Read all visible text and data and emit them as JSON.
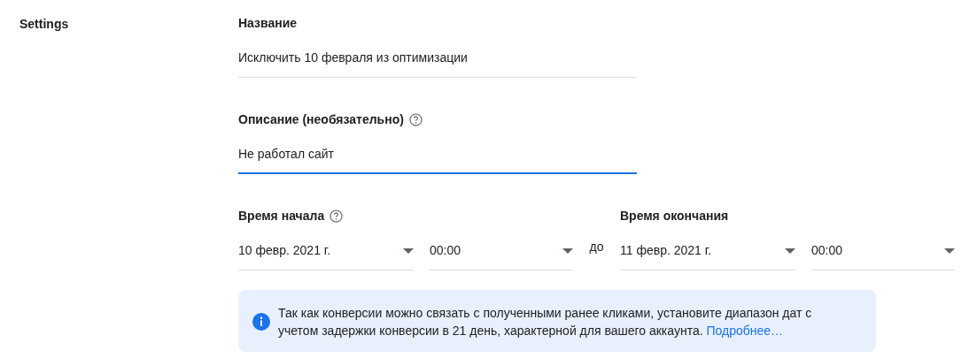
{
  "section_title": "Settings",
  "fields": [
    {
      "label": "Название",
      "help": false,
      "value": "Исключить 10 февраля из оптимизации",
      "focused": false
    },
    {
      "label": "Описание (необязательно)",
      "help": true,
      "value": "Не работал сайт",
      "focused": true
    }
  ],
  "ranges": [
    {
      "label": "Время начала",
      "help": true,
      "date": "10 февр. 2021 г.",
      "time": "00:00"
    },
    {
      "label": "Время окончания",
      "help": false,
      "date": "11 февр. 2021 г.",
      "time": "00:00"
    }
  ],
  "separator": "до",
  "info": {
    "text": "Так как конверсии можно связать с полученными ранее кликами, установите диапазон дат с учетом задержки конверсии в 21 день, характерной для вашего аккаунта.",
    "link": "Подробнее…"
  }
}
